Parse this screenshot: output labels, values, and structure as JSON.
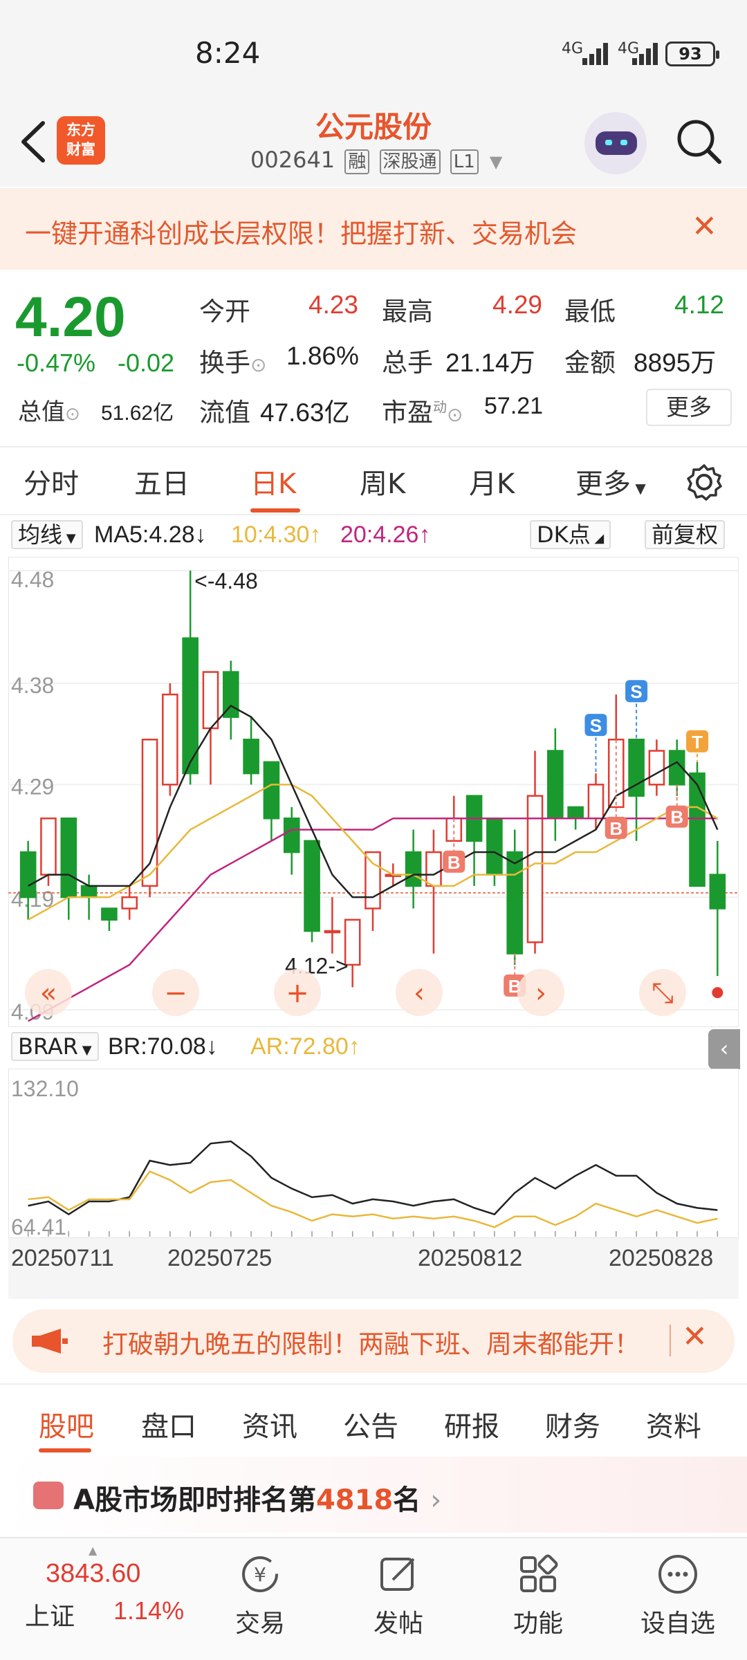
{
  "status_bar": {
    "time": "8:24",
    "net1": "4G",
    "net2": "4G",
    "battery": "93"
  },
  "header": {
    "logo_line1": "东方",
    "logo_line2": "财富",
    "stock_name": "公元股份",
    "stock_code": "002641",
    "tag_margin": "融",
    "tag_connect": "深股通",
    "tag_level": "L1"
  },
  "promo_banner": {
    "text": "一键开通科创成长层权限！把握打新、交易机会"
  },
  "quote": {
    "price": "4.20",
    "change_pct": "-0.47%",
    "change_amt": "-0.02",
    "open_label": "今开",
    "open": "4.23",
    "high_label": "最高",
    "high": "4.29",
    "low_label": "最低",
    "low": "4.12",
    "turnover_label": "换手",
    "turnover": "1.86%",
    "volume_label": "总手",
    "volume": "21.14万",
    "amount_label": "金额",
    "amount": "8895万",
    "mktcap_label": "总值",
    "mktcap": "51.62亿",
    "float_label": "流值",
    "float_cap": "47.63亿",
    "pe_label": "市盈",
    "pe_sup": "动",
    "pe": "57.21",
    "more_label": "更多"
  },
  "period_tabs": [
    "分时",
    "五日",
    "日K",
    "周K",
    "月K",
    "更多"
  ],
  "period_active": "日K",
  "ma_bar": {
    "indicator": "均线",
    "ma5": "MA5:4.28",
    "ma10": "10:4.30",
    "ma20": "20:4.26",
    "dk_label": "DK点",
    "adjust_label": "前复权"
  },
  "colors": {
    "up": "#e03c31",
    "down": "#1a9a2e",
    "ma5": "#222222",
    "ma10": "#e8b83a",
    "ma20": "#c0247e",
    "accent": "#e8542b"
  },
  "kline": {
    "y_labels": [
      "4.48",
      "4.38",
      "4.29",
      "4.19",
      "4.09"
    ],
    "high_note": "<-4.48",
    "low_note": "4.12->",
    "ymin": 4.09,
    "ymax": 4.48
  },
  "chart_data": [
    {
      "type": "candlestick",
      "title": "",
      "ylim": [
        4.09,
        4.48
      ],
      "candles": [
        {
          "o": 4.23,
          "c": 4.19,
          "h": 4.24,
          "l": 4.17
        },
        {
          "o": 4.21,
          "c": 4.26,
          "h": 4.26,
          "l": 4.2
        },
        {
          "o": 4.26,
          "c": 4.19,
          "h": 4.26,
          "l": 4.17
        },
        {
          "o": 4.2,
          "c": 4.19,
          "h": 4.21,
          "l": 4.17
        },
        {
          "o": 4.18,
          "c": 4.17,
          "h": 4.18,
          "l": 4.16
        },
        {
          "o": 4.18,
          "c": 4.19,
          "h": 4.2,
          "l": 4.17
        },
        {
          "o": 4.2,
          "c": 4.33,
          "h": 4.33,
          "l": 4.19
        },
        {
          "o": 4.29,
          "c": 4.37,
          "h": 4.38,
          "l": 4.28
        },
        {
          "o": 4.42,
          "c": 4.3,
          "h": 4.48,
          "l": 4.29
        },
        {
          "o": 4.34,
          "c": 4.39,
          "h": 4.39,
          "l": 4.29
        },
        {
          "o": 4.39,
          "c": 4.35,
          "h": 4.4,
          "l": 4.33
        },
        {
          "o": 4.33,
          "c": 4.3,
          "h": 4.35,
          "l": 4.29
        },
        {
          "o": 4.31,
          "c": 4.26,
          "h": 4.31,
          "l": 4.24
        },
        {
          "o": 4.26,
          "c": 4.23,
          "h": 4.27,
          "l": 4.21
        },
        {
          "o": 4.24,
          "c": 4.16,
          "h": 4.24,
          "l": 4.15
        },
        {
          "o": 4.16,
          "c": 4.16,
          "h": 4.19,
          "l": 4.14
        },
        {
          "o": 4.13,
          "c": 4.17,
          "h": 4.17,
          "l": 4.11
        },
        {
          "o": 4.18,
          "c": 4.23,
          "h": 4.23,
          "l": 4.16
        },
        {
          "o": 4.21,
          "c": 4.21,
          "h": 4.22,
          "l": 4.2
        },
        {
          "o": 4.23,
          "c": 4.2,
          "h": 4.25,
          "l": 4.18
        },
        {
          "o": 4.2,
          "c": 4.23,
          "h": 4.25,
          "l": 4.14
        },
        {
          "o": 4.24,
          "c": 4.26,
          "h": 4.28,
          "l": 4.24
        },
        {
          "o": 4.28,
          "c": 4.24,
          "h": 4.28,
          "l": 4.2
        },
        {
          "o": 4.26,
          "c": 4.21,
          "h": 4.26,
          "l": 4.2
        },
        {
          "o": 4.23,
          "c": 4.14,
          "h": 4.25,
          "l": 4.13
        },
        {
          "o": 4.15,
          "c": 4.28,
          "h": 4.32,
          "l": 4.14
        },
        {
          "o": 4.32,
          "c": 4.26,
          "h": 4.34,
          "l": 4.24
        },
        {
          "o": 4.27,
          "c": 4.26,
          "h": 4.27,
          "l": 4.25
        },
        {
          "o": 4.26,
          "c": 4.29,
          "h": 4.3,
          "l": 4.25
        },
        {
          "o": 4.27,
          "c": 4.33,
          "h": 4.37,
          "l": 4.27
        },
        {
          "o": 4.33,
          "c": 4.28,
          "h": 4.33,
          "l": 4.24
        },
        {
          "o": 4.29,
          "c": 4.32,
          "h": 4.33,
          "l": 4.28
        },
        {
          "o": 4.32,
          "c": 4.29,
          "h": 4.33,
          "l": 4.28
        },
        {
          "o": 4.3,
          "c": 4.2,
          "h": 4.31,
          "l": 4.2
        },
        {
          "o": 4.21,
          "c": 4.18,
          "h": 4.24,
          "l": 4.12
        }
      ],
      "ma5": [
        4.2,
        4.21,
        4.21,
        4.2,
        4.2,
        4.2,
        4.22,
        4.27,
        4.31,
        4.34,
        4.36,
        4.35,
        4.33,
        4.29,
        4.25,
        4.21,
        4.19,
        4.19,
        4.2,
        4.21,
        4.21,
        4.22,
        4.23,
        4.23,
        4.22,
        4.23,
        4.23,
        4.24,
        4.25,
        4.28,
        4.29,
        4.3,
        4.31,
        4.29,
        4.25
      ],
      "ma10": [
        4.17,
        4.18,
        4.19,
        4.19,
        4.19,
        4.2,
        4.21,
        4.23,
        4.25,
        4.26,
        4.27,
        4.28,
        4.29,
        4.29,
        4.28,
        4.26,
        4.24,
        4.22,
        4.21,
        4.21,
        4.2,
        4.2,
        4.21,
        4.21,
        4.21,
        4.22,
        4.22,
        4.23,
        4.23,
        4.24,
        4.25,
        4.26,
        4.27,
        4.27,
        4.26
      ],
      "ma20": [
        4.08,
        4.09,
        4.1,
        4.11,
        4.12,
        4.13,
        4.15,
        4.17,
        4.19,
        4.21,
        4.22,
        4.23,
        4.24,
        4.25,
        4.25,
        4.25,
        4.25,
        4.25,
        4.26,
        4.26,
        4.26,
        4.26,
        4.26,
        4.26,
        4.26,
        4.26,
        4.26,
        4.26,
        4.26,
        4.26,
        4.26,
        4.26,
        4.26,
        4.26,
        4.26
      ],
      "signals": [
        {
          "index": 21,
          "type": "B"
        },
        {
          "index": 24,
          "type": "B"
        },
        {
          "index": 28,
          "type": "S"
        },
        {
          "index": 29,
          "type": "B"
        },
        {
          "index": 30,
          "type": "S"
        },
        {
          "index": 32,
          "type": "B"
        },
        {
          "index": 33,
          "type": "T"
        }
      ]
    },
    {
      "type": "line",
      "title": "BRAR",
      "ylim": [
        64.41,
        132.1
      ],
      "series": [
        {
          "name": "BR:70.08",
          "values": [
            74,
            76,
            70,
            76,
            76,
            78,
            95,
            93,
            94,
            103,
            104,
            97,
            87,
            82,
            78,
            79,
            75,
            77,
            76,
            74,
            76,
            77,
            73,
            70,
            80,
            87,
            82,
            88,
            93,
            88,
            88,
            80,
            75,
            73,
            72
          ]
        },
        {
          "name": "AR:72.80",
          "values": [
            77,
            78,
            72,
            77,
            77,
            77,
            90,
            86,
            80,
            85,
            86,
            80,
            74,
            71,
            67,
            70,
            69,
            70,
            68,
            69,
            68,
            69,
            67,
            64,
            69,
            69,
            65,
            69,
            75,
            72,
            69,
            72,
            69,
            66,
            68
          ]
        }
      ],
      "x_labels": [
        "20250711",
        "20250725",
        "20250812",
        "20250828"
      ]
    }
  ],
  "brar_bar": {
    "indicator": "BRAR",
    "br": "BR:70.08",
    "ar": "AR:72.80",
    "y_max": "132.10",
    "y_min": "64.41"
  },
  "dates": [
    "20250711",
    "20250725",
    "20250812",
    "20250828"
  ],
  "promo2": {
    "text": "打破朝九晚五的限制！两融下班、周末都能开！"
  },
  "info_tabs": [
    "股吧",
    "盘口",
    "资讯",
    "公告",
    "研报",
    "财务",
    "资料"
  ],
  "info_active": "股吧",
  "rank": {
    "prefix": "A股市场即时排名第",
    "number": "4818",
    "suffix": "名"
  },
  "bottom_nav": {
    "index_value": "3843.60",
    "index_name": "上证",
    "index_pct": "1.14%",
    "items": [
      "交易",
      "发帖",
      "功能",
      "设自选"
    ]
  }
}
